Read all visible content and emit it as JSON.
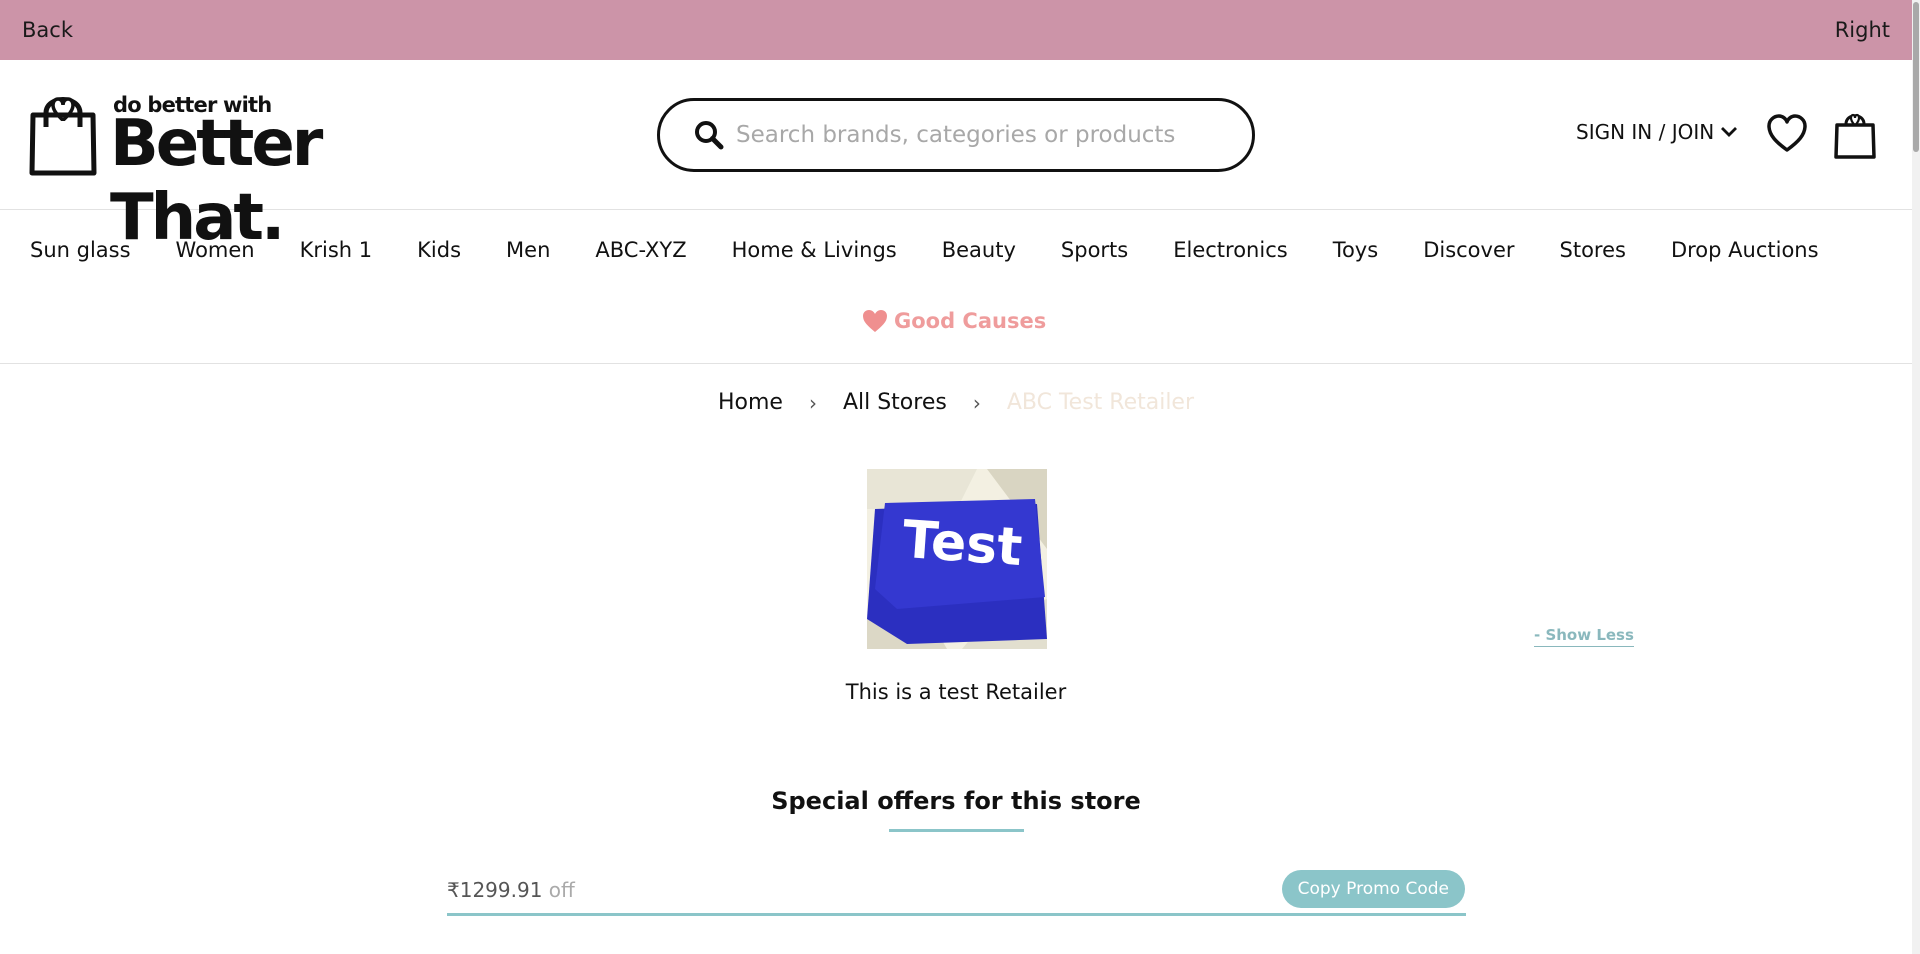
{
  "topbar": {
    "back_label": "Back",
    "right_label": "Right"
  },
  "header": {
    "logo_tagline": "do better with",
    "logo_name": "Better That.",
    "search_placeholder": "Search brands, categories or products",
    "account_label": "SIGN IN / JOIN"
  },
  "nav": {
    "items": [
      "Sun glass",
      "Women",
      "Krish 1",
      "Kids",
      "Men",
      "ABC-XYZ",
      "Home & Livings",
      "Beauty",
      "Sports",
      "Electronics",
      "Toys",
      "Discover",
      "Stores",
      "Drop Auctions"
    ],
    "good_causes_label": "Good Causes"
  },
  "breadcrumb": {
    "home": "Home",
    "all_stores": "All Stores",
    "current": "ABC Test Retailer"
  },
  "store": {
    "image_text": "Test",
    "show_less_label": "- Show Less",
    "description": "This is a test Retailer"
  },
  "offers": {
    "title": "Special offers for this store",
    "items": [
      {
        "amount": "₹1299.91",
        "suffix": " off",
        "button_label": "Copy Promo Code"
      }
    ]
  },
  "colors": {
    "topbar_bg": "#cc94a8",
    "accent_teal": "#8bc5c9",
    "good_causes": "#ef9c9c",
    "store_key_blue": "#2b2fc0"
  }
}
